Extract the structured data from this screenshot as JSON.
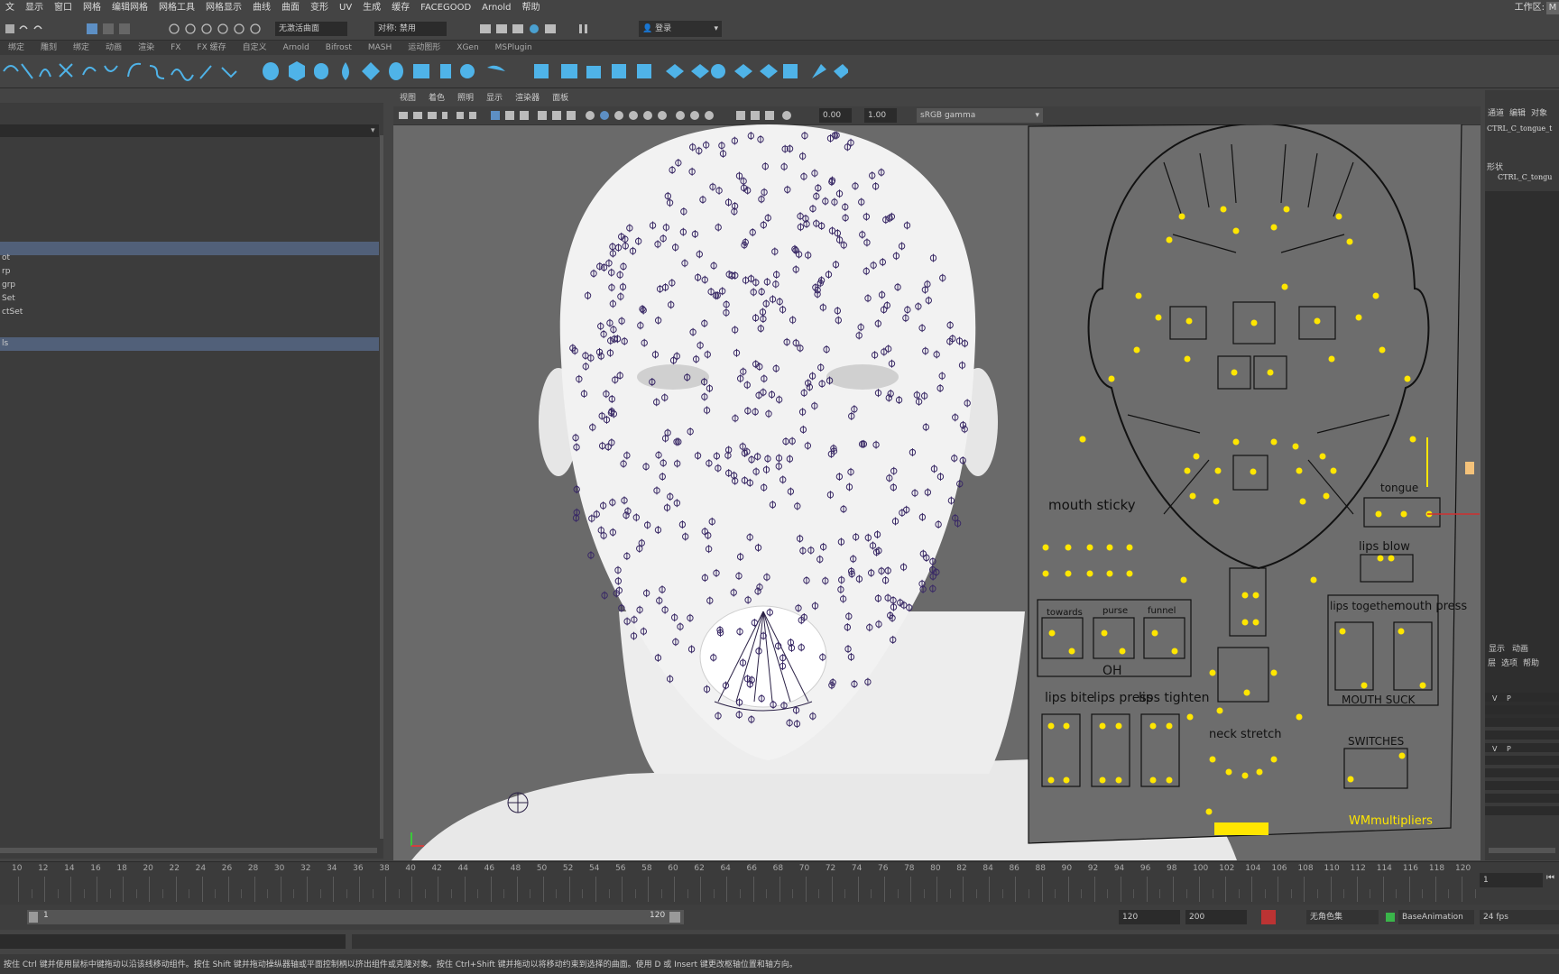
{
  "menubar": {
    "items": [
      "文",
      "显示",
      "窗口",
      "网格",
      "编辑网格",
      "网格工具",
      "网格显示",
      "曲线",
      "曲面",
      "变形",
      "UV",
      "生成",
      "缓存",
      "FACEGOOD",
      "Arnold",
      "帮助"
    ],
    "workspace_label": "工作区:",
    "workspace_value": "M"
  },
  "statusline": {
    "object_mode": "无激活曲面",
    "symmetry": "对称: 禁用",
    "login": "登录"
  },
  "shelf_tabs": [
    "绑定",
    "雕刻",
    "绑定",
    "动画",
    "渲染",
    "FX",
    "FX 缓存",
    "自定义",
    "Arnold",
    "Bifrost",
    "MASH",
    "运动图形",
    "XGen",
    "MSPlugin"
  ],
  "outliner": {
    "items": [
      "ot",
      "rp",
      "grp",
      "Set",
      "ctSet",
      "ls"
    ]
  },
  "viewport": {
    "menu": [
      "视图",
      "着色",
      "照明",
      "显示",
      "渲染器",
      "面板"
    ],
    "exposure": "0.00",
    "gamma": "1.00",
    "color_space": "sRGB gamma"
  },
  "facial_board": {
    "labels": {
      "mouth_sticky": "mouth sticky",
      "tongue": "tongue",
      "lips_blow": "lips blow",
      "towards": "towards",
      "purse": "purse",
      "funnel": "funnel",
      "oh": "OH",
      "lips_together": "lips together",
      "mouth_press": "mouth press",
      "mouth_suck": "MOUTH SUCK",
      "lips_bite": "lips bite",
      "lips_press": "lips press",
      "lips_tighten": "lips tighten",
      "neck_stretch": "neck stretch",
      "switches": "SWITCHES",
      "wm_multipliers": "WMmultipliers"
    }
  },
  "right_panel": {
    "tabs": [
      "通道",
      "编辑",
      "对象"
    ],
    "node_name": "CTRL_C_tongue_t",
    "shapes_label": "形状",
    "shape_name": "CTRL_C_tongu",
    "layer_tabs": [
      "显示",
      "动画"
    ],
    "layer_menu": [
      "层",
      "选项",
      "帮助"
    ]
  },
  "timeline": {
    "ticks": [
      "10",
      "12",
      "14",
      "16",
      "18",
      "20",
      "22",
      "24",
      "26",
      "28",
      "30",
      "32",
      "34",
      "36",
      "38",
      "40",
      "42",
      "44",
      "46",
      "48",
      "50",
      "52",
      "54",
      "56",
      "58",
      "60",
      "62",
      "64",
      "66",
      "68",
      "70",
      "72",
      "74",
      "76",
      "78",
      "80",
      "82",
      "84",
      "86",
      "88",
      "90",
      "92",
      "94",
      "96",
      "98",
      "100",
      "102",
      "104",
      "106",
      "108",
      "110",
      "112",
      "114",
      "116",
      "118",
      "120"
    ],
    "current_frame": "1"
  },
  "range": {
    "start": "1",
    "end": "120",
    "anim_end": "120",
    "max": "200",
    "character_set": "无角色集",
    "anim_layer": "BaseAnimation",
    "fps": "24 fps"
  },
  "helpline": {
    "text": "按住 Ctrl 键并使用鼠标中键拖动以沿该线移动组件。按住 Shift 键并拖动操纵器轴或平面控制柄以挤出组件或克隆对象。按住 Ctrl+Shift 键并拖动以将移动约束到选择的曲面。使用 D 或 Insert 键更改枢轴位置和轴方向。"
  },
  "colors": {
    "ui_bg": "#444444",
    "viewport_bg": "#6a6a6a",
    "control_yellow": "#ffe600",
    "locator_purple": "#3a2a66",
    "face_white": "#f2f2f2"
  }
}
